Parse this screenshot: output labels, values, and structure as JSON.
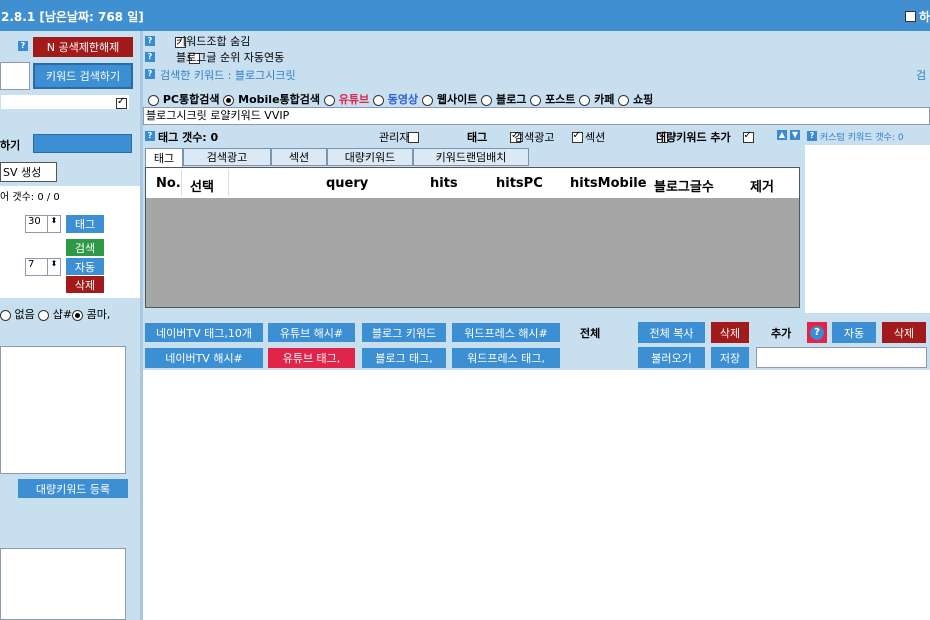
{
  "title": "2.8.1 [남은날짜: 768 일]",
  "title_right_checkbox": "하",
  "left": {
    "unlock_button": "N 공색제한해제",
    "search_keyword_button": "키워드 검색하기",
    "partial_label": "하기",
    "csv_button": "SV 생성",
    "count_label": "어 갯수: 0 / 0",
    "num1": "30",
    "num2": "7",
    "tag_button": "태그",
    "search_button": "검색",
    "auto_button": "자동",
    "delete_button": "삭제",
    "radio_none": "없음",
    "radio_shop": "샵#",
    "radio_comma": "콤마,",
    "bulk_register_button": "대량키워드 등록"
  },
  "top": {
    "hide_combo_label": "키워드조합 숨김",
    "blog_rank_label": "블로그글 순위 자동연동",
    "searched_keyword": "검색한 키워드 : 블로그시크릿",
    "search_right": "검",
    "radios": [
      "PC통합검색",
      "Mobile통합검색",
      "유튜브",
      "동영상",
      "웹사이트",
      "블로그",
      "포스트",
      "카페",
      "쇼핑"
    ],
    "keyword_value": "블로그시크릿 로얄키워드 VVIP"
  },
  "options": {
    "tag_count": "태그 갯수: 0",
    "admin": "관리자",
    "tag": "태그",
    "search_ad": "검색광고",
    "section": "섹션",
    "bulk_add": "대량키워드 추가",
    "custom_count": "커스텀 키워드 갯수: 0"
  },
  "tabs": [
    "태그",
    "검색광고",
    "섹션",
    "대량키워드",
    "키워드랜덤배치"
  ],
  "grid": {
    "columns": [
      "No.",
      "선택",
      "query",
      "hits",
      "hitsPC",
      "hitsMobile",
      "블로그글수",
      "제거"
    ]
  },
  "bottom": {
    "naver_tv_tag": "네이버TV 태그,10개",
    "youtube_hash": "유튜브 해시#",
    "blog_keyword": "블로그 키워드",
    "wp_hash": "워드프레스 해시#",
    "all_label": "전체",
    "copy_all": "전체 복사",
    "delete1": "삭제",
    "add_label": "추가",
    "auto": "자동",
    "delete2": "삭제",
    "naver_tv_hash": "네이버TV 해시#",
    "youtube_tag": "유튜브 태그,",
    "blog_tag": "블로그 태그,",
    "wp_tag": "워드프레스 태그,",
    "load": "불러오기",
    "save": "저장"
  },
  "colors": {
    "titlebar": "#3f8fd1",
    "panel": "#c8dff0",
    "button_blue": "#3c8fd3",
    "button_red": "#a31a1a",
    "button_pink": "#e0244a",
    "button_green": "#2e9a46"
  }
}
